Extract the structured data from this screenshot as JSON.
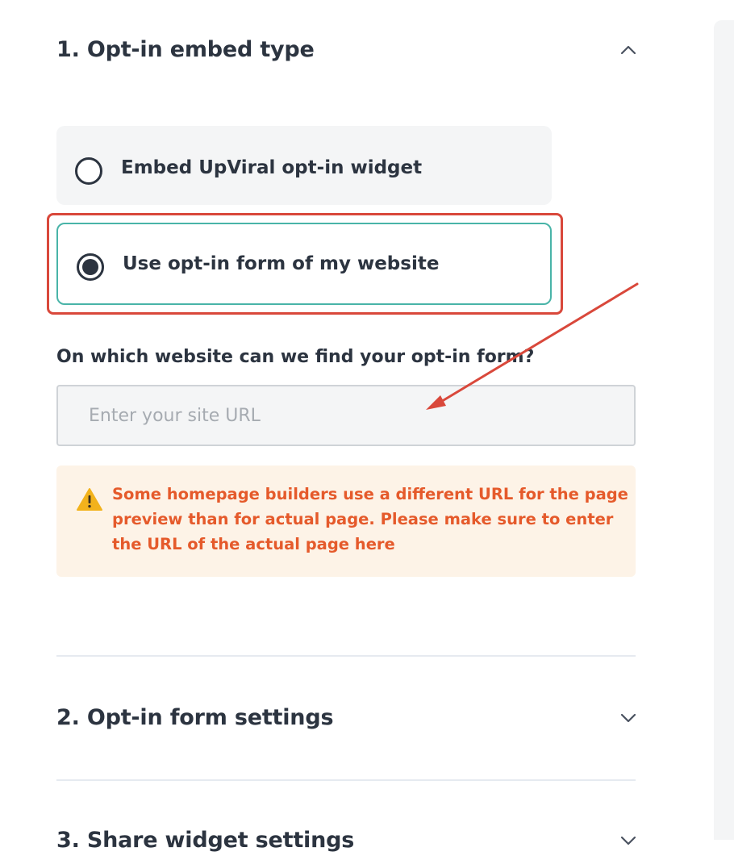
{
  "sections": [
    {
      "title": "1. Opt-in embed type",
      "chevron": "chevron-up-icon"
    },
    {
      "title": "2. Opt-in form settings",
      "chevron": "chevron-down-icon"
    },
    {
      "title": "3. Share widget settings",
      "chevron": "chevron-down-icon"
    }
  ],
  "embed_options": [
    {
      "label": "Embed UpViral opt-in widget",
      "selected": false
    },
    {
      "label": "Use opt-in form of my website",
      "selected": true
    }
  ],
  "site_url": {
    "label": "On which website can we find your opt-in form?",
    "placeholder": "Enter your site URL",
    "value": ""
  },
  "warning": {
    "icon": "warning-triangle-icon",
    "text": "Some homepage builders use a different URL for the page preview than for actual page. Please make sure to enter the URL of the actual page here"
  },
  "colors": {
    "accent": "#49b4a8",
    "annotation": "#d9483b",
    "warning_text": "#e55a2b",
    "warning_bg": "#fdf3e7"
  }
}
